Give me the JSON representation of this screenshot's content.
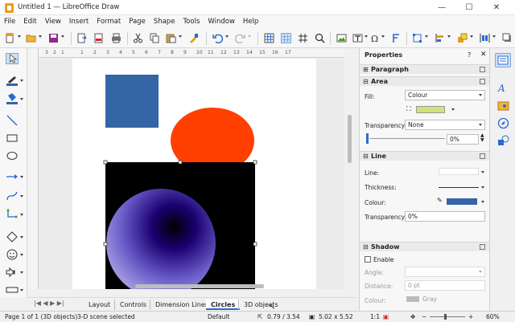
{
  "window": {
    "title": "Untitled 1 — LibreOffice Draw",
    "minimize": "—",
    "maximize": "☐",
    "close": "✕"
  },
  "menu": [
    "File",
    "Edit",
    "View",
    "Insert",
    "Format",
    "Page",
    "Shape",
    "Tools",
    "Window",
    "Help"
  ],
  "ruler_ticks": [
    "3",
    "2",
    "1",
    "",
    "1",
    "2",
    "3",
    "4",
    "5",
    "6",
    "7",
    "8",
    "9",
    "10",
    "11",
    "12",
    "13",
    "14",
    "15",
    "16",
    "17"
  ],
  "tabs": [
    {
      "label": "Layout"
    },
    {
      "label": "Controls"
    },
    {
      "label": "Dimension Lines"
    },
    {
      "label": "Circles",
      "active": true
    },
    {
      "label": "3D objects"
    }
  ],
  "status": {
    "page": "Page 1 of 1 (3D objects)",
    "selection": "3-D scene selected",
    "style": "Default",
    "position": "0.79 / 3.54",
    "size": "5.02 x 5.52",
    "scale": "1:1",
    "zoom": "60%"
  },
  "sidebar": {
    "title": "Properties",
    "paragraph": {
      "title": "Paragraph"
    },
    "area": {
      "title": "Area",
      "fill_label": "Fill:",
      "fill_value": "Colour",
      "fill_color": "#d4e17a",
      "transparency_label": "Transparency:",
      "transparency_value": "None",
      "transparency_percent": "0%"
    },
    "line": {
      "title": "Line",
      "line_label": "Line:",
      "thickness_label": "Thickness:",
      "colour_label": "Colour:",
      "line_color": "#3465a4",
      "transparency_label": "Transparency:",
      "transparency_value": "0%"
    },
    "shadow": {
      "title": "Shadow",
      "enable_label": "Enable",
      "angle_label": "Angle:",
      "distance_label": "Distance:",
      "distance_value": "0 pt",
      "colour_label": "Colour:",
      "colour_value": "Gray"
    }
  },
  "colors": {
    "square": "#3465a4",
    "ellipse_top": "#ff4000",
    "ellipse_bottom": "#00b0f0",
    "scene_bg": "#000000",
    "sphere_light": "#b4a8e8",
    "sphere_dark": "#1a0070"
  }
}
